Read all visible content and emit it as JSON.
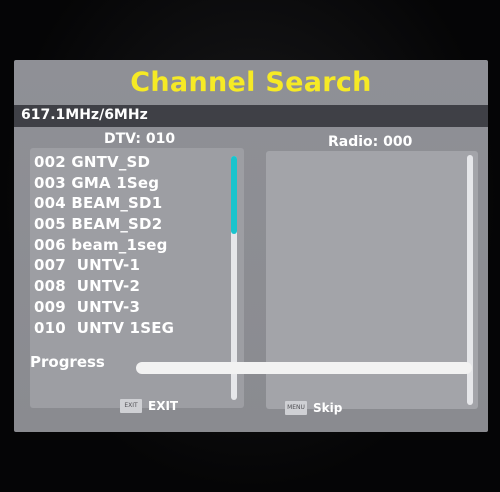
{
  "title": "Channel Search",
  "frequency": "617.1MHz/6MHz",
  "dtv": {
    "label": "DTV: 010",
    "channels": [
      "002 GNTV_SD",
      "003 GMA 1Seg",
      "004 BEAM_SD1",
      "005 BEAM_SD2",
      "006 beam_1seg",
      "007  UNTV-1",
      "008  UNTV-2",
      "009  UNTV-3",
      "010  UNTV 1SEG"
    ]
  },
  "radio": {
    "label": "Radio: 000",
    "channels": []
  },
  "progress": {
    "label": "Progress",
    "value": 0
  },
  "keys": {
    "exit": {
      "icon_text": "EXIT",
      "label": "EXIT"
    },
    "skip": {
      "icon_text": "MENU",
      "label": "Skip"
    }
  },
  "colors": {
    "title": "#f6ea25",
    "accent": "#19c4cd",
    "panel": "#8f9096",
    "bar": "#3f4046"
  }
}
